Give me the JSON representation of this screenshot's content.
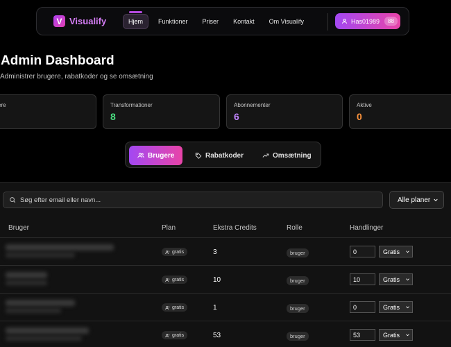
{
  "nav": {
    "brand": "Visualify",
    "brand_mark": "V",
    "links": [
      "Hjem",
      "Funktioner",
      "Priser",
      "Kontakt",
      "Om Visualify"
    ],
    "user": {
      "name": "Has01989",
      "badge": "88"
    }
  },
  "header": {
    "title": "Admin Dashboard",
    "subtitle": "Administrer brugere, rabatkoder og se omsætning"
  },
  "stats": [
    {
      "label": "ere",
      "value": "",
      "color": "#ffffff"
    },
    {
      "label": "Transformationer",
      "value": "8",
      "color": "#4ade80"
    },
    {
      "label": "Abonnementer",
      "value": "6",
      "color": "#c084fc"
    },
    {
      "label": "Aktive",
      "value": "0",
      "color": "#fb923c"
    }
  ],
  "tabs": {
    "users": "Brugere",
    "codes": "Rabatkoder",
    "revenue": "Omsætning"
  },
  "filters": {
    "search_placeholder": "Søg efter email eller navn...",
    "plan_filter": "Alle planer"
  },
  "table": {
    "headers": [
      "Bruger",
      "Plan",
      "Ekstra Credits",
      "Rolle",
      "Handlinger"
    ],
    "rows": [
      {
        "plan": "gratis",
        "credits": "3",
        "role": "bruger",
        "input": "0",
        "select": "Gratis"
      },
      {
        "plan": "gratis",
        "credits": "10",
        "role": "bruger",
        "input": "10",
        "select": "Gratis"
      },
      {
        "plan": "gratis",
        "credits": "1",
        "role": "bruger",
        "input": "0",
        "select": "Gratis"
      },
      {
        "plan": "gratis",
        "credits": "53",
        "role": "bruger",
        "input": "53",
        "select": "Gratis"
      }
    ]
  }
}
